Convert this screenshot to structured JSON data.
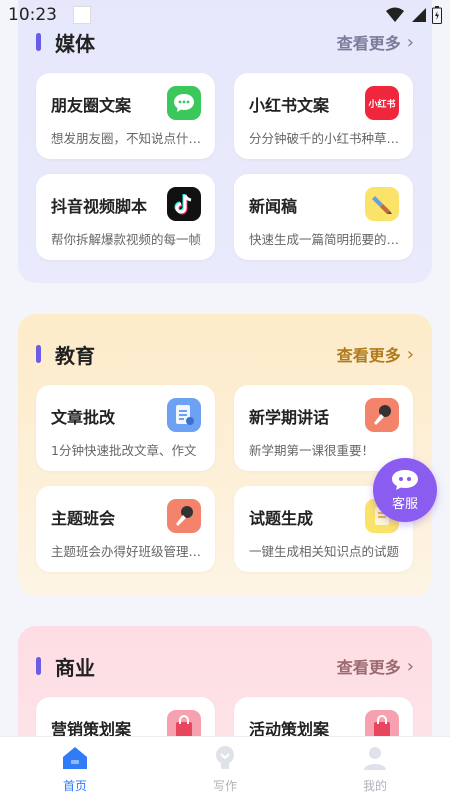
{
  "status_bar": {
    "time": "10:23"
  },
  "colors": {
    "accent": "#2f7cf6",
    "media_bar": "#6b5ce8",
    "edu_more": "#b07a1d",
    "biz_more": "#9a6a70",
    "fab": "#8a5cf0"
  },
  "sections": {
    "media": {
      "title": "媒体",
      "more": "查看更多",
      "cards": [
        {
          "title": "朋友圈文案",
          "subtitle": "想发朋友圈，不知说点什么？",
          "icon": "chat-bubble-icon"
        },
        {
          "title": "小红书文案",
          "subtitle": "分分钟破千的小红书种草文案",
          "icon": "xiaohongshu-icon",
          "icon_text": "小红书"
        },
        {
          "title": "抖音视频脚本",
          "subtitle": "帮你拆解爆款视频的每一帧",
          "icon": "tiktok-icon"
        },
        {
          "title": "新闻稿",
          "subtitle": "快速生成一篇简明扼要的新闻稿",
          "icon": "pen-icon"
        }
      ]
    },
    "education": {
      "title": "教育",
      "more": "查看更多",
      "cards": [
        {
          "title": "文章批改",
          "subtitle": "1分钟快速批改文章、作文",
          "icon": "document-edit-icon"
        },
        {
          "title": "新学期讲话",
          "subtitle": "新学期第一课很重要！",
          "icon": "microphone-icon"
        },
        {
          "title": "主题班会",
          "subtitle": "主题班会办得好班级管理更轻松",
          "icon": "microphone-icon"
        },
        {
          "title": "试题生成",
          "subtitle": "一键生成相关知识点的试题",
          "icon": "notepad-icon"
        }
      ]
    },
    "business": {
      "title": "商业",
      "more": "查看更多",
      "cards": [
        {
          "title": "营销策划案",
          "icon": "shopping-bag-icon"
        },
        {
          "title": "活动策划案",
          "icon": "shopping-bag-icon"
        }
      ]
    }
  },
  "fab": {
    "label": "客服"
  },
  "tabs": [
    {
      "label": "首页",
      "icon": "home-icon",
      "active": true
    },
    {
      "label": "写作",
      "icon": "write-bulb-icon",
      "active": false
    },
    {
      "label": "我的",
      "icon": "user-icon",
      "active": false
    }
  ]
}
